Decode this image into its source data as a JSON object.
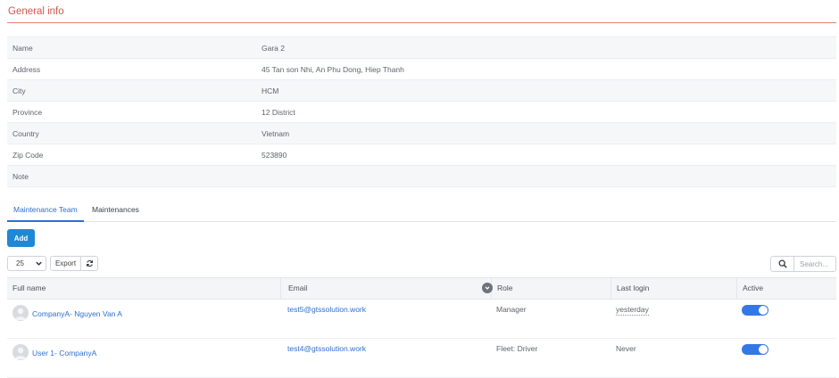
{
  "section": {
    "title": "General info"
  },
  "info": [
    {
      "label": "Name",
      "value": "Gara 2"
    },
    {
      "label": "Address",
      "value": "45 Tan son Nhi, An Phu Dong, Hiep Thanh"
    },
    {
      "label": "City",
      "value": "HCM"
    },
    {
      "label": "Province",
      "value": "12 District"
    },
    {
      "label": "Country",
      "value": "Vietnam"
    },
    {
      "label": "Zip Code",
      "value": "523890"
    },
    {
      "label": "Note",
      "value": ""
    }
  ],
  "tabs": [
    {
      "label": "Maintenance Team",
      "active": true
    },
    {
      "label": "Maintenances",
      "active": false
    }
  ],
  "toolbar": {
    "add_label": "Add",
    "page_size": "25",
    "export_label": "Export",
    "refresh_icon": "refresh-icon",
    "search_icon": "search-icon",
    "search_placeholder": "Search..."
  },
  "table": {
    "columns": [
      "Full name",
      "Email",
      "Role",
      "Last login",
      "Active"
    ],
    "rows": [
      {
        "name": "CompanyA- Nguyen Van A",
        "email": "test5@gtssolution.work",
        "role": "Manager",
        "last_login": "yesterday",
        "active": true
      },
      {
        "name": "User 1- CompanyA",
        "email": "test4@gtssolution.work",
        "role": "Fleet: Driver",
        "last_login": "Never",
        "active": true
      }
    ]
  },
  "colors": {
    "title": "#d9534f",
    "primary": "#1e88d6",
    "link": "#2d6fcf",
    "toggle_on": "#3478e6"
  }
}
